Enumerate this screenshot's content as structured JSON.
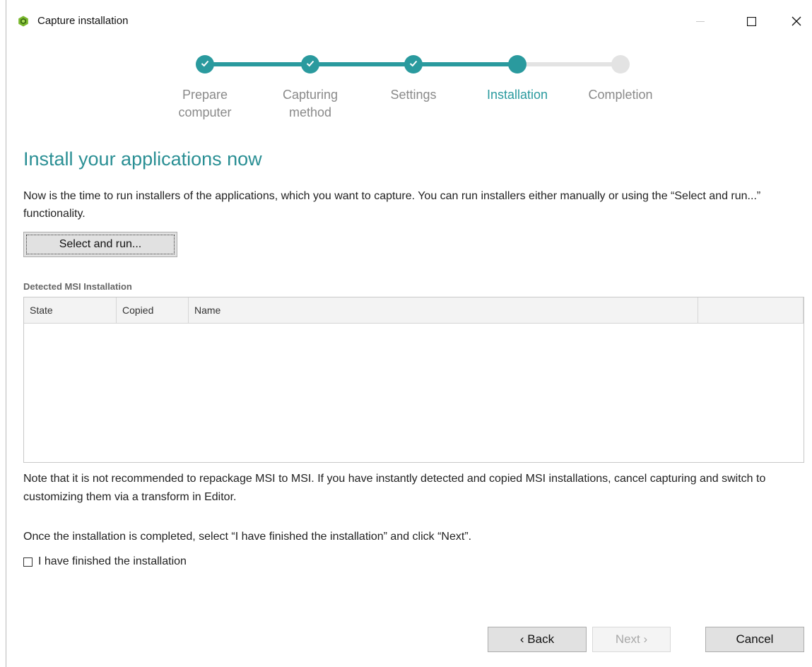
{
  "window": {
    "title": "Capture installation",
    "app_icon": "app-hexagon-icon"
  },
  "title_buttons": {
    "minimize": "minimize-icon",
    "maximize": "maximize-icon",
    "close": "close-icon"
  },
  "colors": {
    "accent": "#2a9a9e",
    "heading": "#2a8f94",
    "inactive_step": "#e0e0e0"
  },
  "stepper": {
    "steps": [
      {
        "label_line1": "Prepare",
        "label_line2": "computer",
        "state": "done"
      },
      {
        "label_line1": "Capturing",
        "label_line2": "method",
        "state": "done"
      },
      {
        "label_line1": "Settings",
        "label_line2": "",
        "state": "done"
      },
      {
        "label_line1": "Installation",
        "label_line2": "",
        "state": "active"
      },
      {
        "label_line1": "Completion",
        "label_line2": "",
        "state": "pending"
      }
    ]
  },
  "main": {
    "heading": "Install your applications now",
    "description": "Now is the time to run installers of the applications, which you want to capture. You can run installers either manually or using the “Select and run...” functionality.",
    "select_run_label": "Select and run...",
    "table_group_label": "Detected MSI Installation",
    "table_columns": [
      "State",
      "Copied",
      "Name",
      ""
    ],
    "note": "Note that it is not recommended to repackage MSI to MSI. If you have instantly detected and copied MSI installations, cancel capturing and switch to customizing them via a transform in Editor.",
    "once_text": "Once the installation is completed, select “I have finished the installation” and click “Next”.",
    "checkbox_label": "I have finished the installation",
    "checkbox_checked": false
  },
  "footer": {
    "back_label": "‹ Back",
    "next_label": "Next ›",
    "cancel_label": "Cancel"
  }
}
